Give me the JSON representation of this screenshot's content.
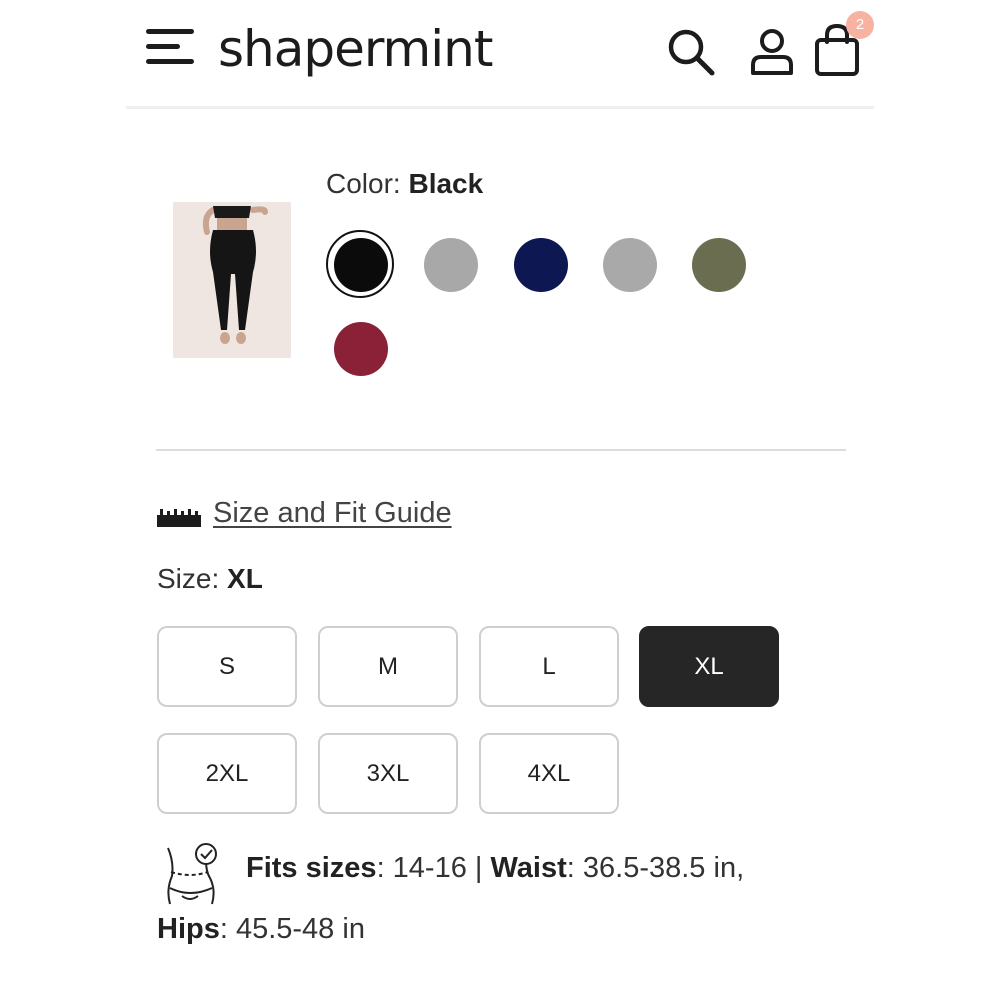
{
  "header": {
    "logo": "shapermint",
    "cart_count": "2"
  },
  "product": {
    "color_label": "Color:",
    "color_value": "Black",
    "swatches": [
      {
        "name": "black",
        "color": "#0b0b0b",
        "selected": true
      },
      {
        "name": "gray-1",
        "color": "#a8a8a8"
      },
      {
        "name": "navy",
        "color": "#0d1752"
      },
      {
        "name": "gray-2",
        "color": "#a9a9a9"
      },
      {
        "name": "olive",
        "color": "#6b6d50"
      },
      {
        "name": "burgundy",
        "color": "#8a2137"
      }
    ],
    "size_guide_label": "Size and Fit Guide",
    "size_label": "Size:",
    "size_value": "XL",
    "sizes": [
      "S",
      "M",
      "L",
      "XL",
      "2XL",
      "3XL",
      "4XL"
    ],
    "selected_size": "XL",
    "fit": {
      "fits_label": "Fits sizes",
      "fits_value": ": 14-16 | ",
      "waist_label": "Waist",
      "waist_value": ": 36.5-38.5 in,",
      "hips_label": "Hips",
      "hips_value": ": 45.5-48 in"
    }
  }
}
